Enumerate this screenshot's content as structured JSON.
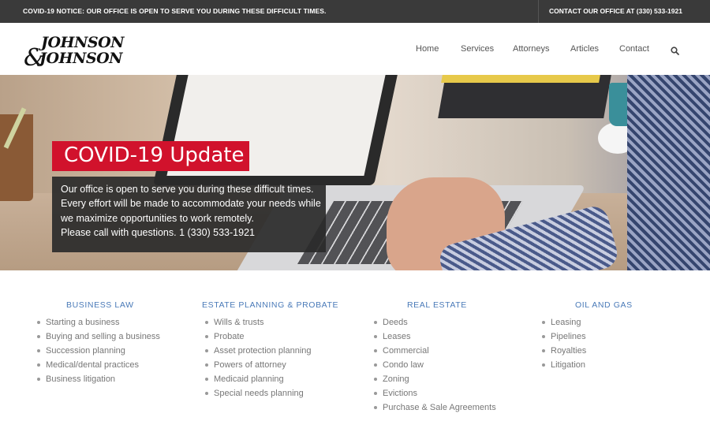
{
  "topbar": {
    "notice": "COVID-19 NOTICE: OUR OFFICE IS OPEN TO SERVE YOU DURING THESE DIFFICULT TIMES.",
    "contact": "CONTACT OUR OFFICE AT (330) 533-1921"
  },
  "header": {
    "logo_alt": "Johnson & Johnson",
    "nav": [
      "Home",
      "Services",
      "Attorneys",
      "Articles",
      "Contact"
    ],
    "search_icon": "search-icon"
  },
  "hero": {
    "badge": "COVID-19 Update",
    "lines": [
      "Our office is open to serve you during these difficult times.",
      "Every effort will be made to accommodate your needs while",
      "we maximize opportunities to work remotely.",
      "Please call with questions. 1 (330) 533-1921"
    ]
  },
  "areas": [
    {
      "title": "BUSINESS LAW",
      "items": [
        "Starting a business",
        "Buying and selling a business",
        "Succession planning",
        "Medical/dental practices",
        "Business litigation"
      ]
    },
    {
      "title": "ESTATE PLANNING & PROBATE",
      "items": [
        "Wills & trusts",
        "Probate",
        "Asset protection planning",
        "Powers of attorney",
        "Medicaid planning",
        "Special needs planning"
      ]
    },
    {
      "title": "REAL ESTATE",
      "items": [
        "Deeds",
        "Leases",
        "Commercial",
        "Condo law",
        "Zoning",
        "Evictions",
        "Purchase & Sale Agreements"
      ]
    },
    {
      "title": "OIL AND GAS",
      "items": [
        "Leasing",
        "Pipelines",
        "Royalties",
        "Litigation"
      ]
    }
  ],
  "colors": {
    "topbar": "#3a3a3a",
    "accent_red": "#d1122c",
    "heading_blue": "#4a7ab8"
  }
}
